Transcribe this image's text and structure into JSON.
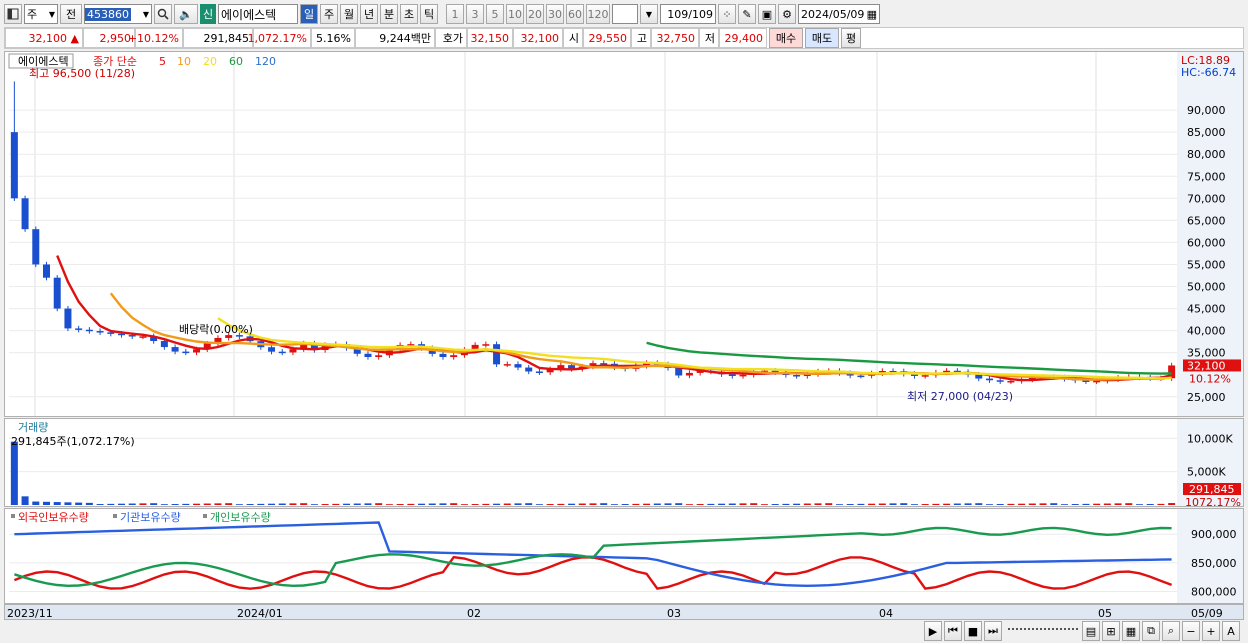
{
  "toolbar": {
    "period": "주",
    "prev": "전",
    "code": "453860",
    "new_badge": "신",
    "name": "에이에스텍",
    "units": [
      "일",
      "주",
      "월",
      "년",
      "분",
      "초",
      "틱"
    ],
    "minutes": [
      "1",
      "3",
      "5",
      "10",
      "20",
      "30",
      "60",
      "120"
    ],
    "count": "109",
    "total": "/109",
    "date": "2024/05/09"
  },
  "quote": {
    "price": "32,100",
    "change": "2,950",
    "rate": "+10.12%",
    "volume": "291,845",
    "vol_ratio": "1,072.17%",
    "turnover": "5.16%",
    "amount": "9,244백만",
    "ask_label": "호가",
    "ask": "32,150",
    "bid": "32,100",
    "open_label": "시",
    "open": "29,550",
    "high_label": "고",
    "high": "32,750",
    "low_label": "저",
    "low": "29,400",
    "buy": "매수",
    "sell": "매도",
    "eval": "평"
  },
  "price_panel": {
    "title": "에이에스텍",
    "series_label": "종가 단순",
    "ma": [
      "5",
      "10",
      "20",
      "60",
      "120"
    ],
    "max_label": "최고 96,500 (11/28)",
    "min_label": "최저 27,000 (04/23)",
    "dividend": "배당락(0.00%)",
    "lc": "LC:18.89",
    "hc": "HC:-66.74",
    "price_tag": "32,100",
    "pct_tag": "10.12%",
    "yticks": [
      "90,000",
      "85,000",
      "80,000",
      "75,000",
      "70,000",
      "65,000",
      "60,000",
      "55,000",
      "50,000",
      "45,000",
      "40,000",
      "35,000",
      "25,000"
    ]
  },
  "volume_panel": {
    "title": "거래량",
    "value_label": "291,845주(1,072.17%)",
    "yticks": [
      "10,000K",
      "5,000K"
    ],
    "tag": "291,845",
    "tag2": "1072.17%"
  },
  "holdings_panel": {
    "legend": [
      "외국인보유수량",
      "기관보유수량",
      "개인보유수량"
    ],
    "yticks": [
      "900,000",
      "850,000",
      "800,000"
    ]
  },
  "xaxis": {
    "labels": [
      "2023/11",
      "2024/01",
      "02",
      "03",
      "04",
      "05",
      "05/09"
    ]
  },
  "colors": {
    "up": "#e01010",
    "down": "#1a4fd0",
    "ma5": "#e01010",
    "ma10": "#f29a1a",
    "ma20": "#f0e020",
    "ma60": "#1a9a40",
    "ma120": "#2a70c8"
  },
  "chart_data": {
    "type": "candlestick",
    "title": "에이에스텍",
    "ylim": [
      22000,
      100000
    ],
    "price_max": 96500,
    "price_min": 27000,
    "last_close": 32100,
    "volume_last": 291845,
    "volume_ylim": [
      0,
      12000000
    ],
    "holdings_ylim": [
      780000,
      930000
    ],
    "x_labels": [
      "2023/11",
      "2024/01",
      "02",
      "03",
      "04",
      "05",
      "05/09"
    ],
    "series": [
      "외국인보유수량",
      "기관보유수량",
      "개인보유수량"
    ]
  }
}
